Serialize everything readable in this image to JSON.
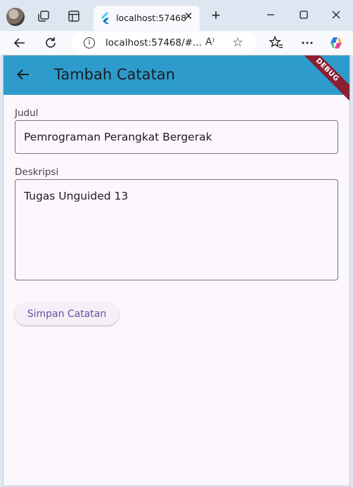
{
  "browser": {
    "tab_title": "localhost:57468",
    "tab_close_glyph": "✕",
    "new_tab_glyph": "+",
    "url": "localhost:57468/#...",
    "read_aloud_label": "A⁾",
    "icons": [
      "profile-avatar",
      "workspaces-icon",
      "tab-actions-icon",
      "flutter-favicon",
      "minimize-icon",
      "maximize-icon",
      "close-window-icon",
      "back-icon",
      "refresh-icon",
      "info-icon",
      "read-aloud-icon",
      "favorite-star-icon",
      "favorites-icon",
      "more-icon",
      "copilot-icon"
    ]
  },
  "app": {
    "title": "Tambah Catatan",
    "debug_banner": "DEBUG",
    "appbar_color": "#2d9ccc",
    "background_color": "#fcf6fd",
    "fields": {
      "judul": {
        "label": "Judul",
        "value": "Pemrograman Perangkat Bergerak"
      },
      "deskripsi": {
        "label": "Deskripsi",
        "value": "Tugas Unguided 13"
      }
    },
    "save_button": "Simpan Catatan",
    "accent_color": "#6750a4"
  }
}
